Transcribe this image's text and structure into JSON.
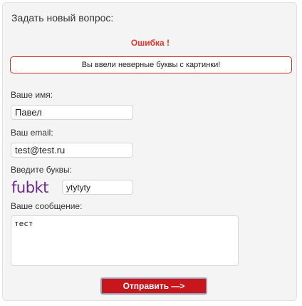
{
  "form": {
    "title": "Задать новый вопрос:",
    "error_heading": "Ошибка !",
    "error_message": "Вы ввели неверные буквы с картинки!",
    "name_label": "Ваше имя:",
    "name_value": "Павел",
    "email_label": "Ваш email:",
    "email_value": "test@test.ru",
    "captcha_label": "Введите буквы:",
    "captcha_text": "fubkt",
    "captcha_value": "ytytyty",
    "message_label": "Ваше сообщение:",
    "message_value": "тест",
    "submit_label": "Отправить —>"
  },
  "colors": {
    "error_red": "#e0352a",
    "button_red": "#c8161d",
    "captcha_purple": "#6a2b86"
  }
}
